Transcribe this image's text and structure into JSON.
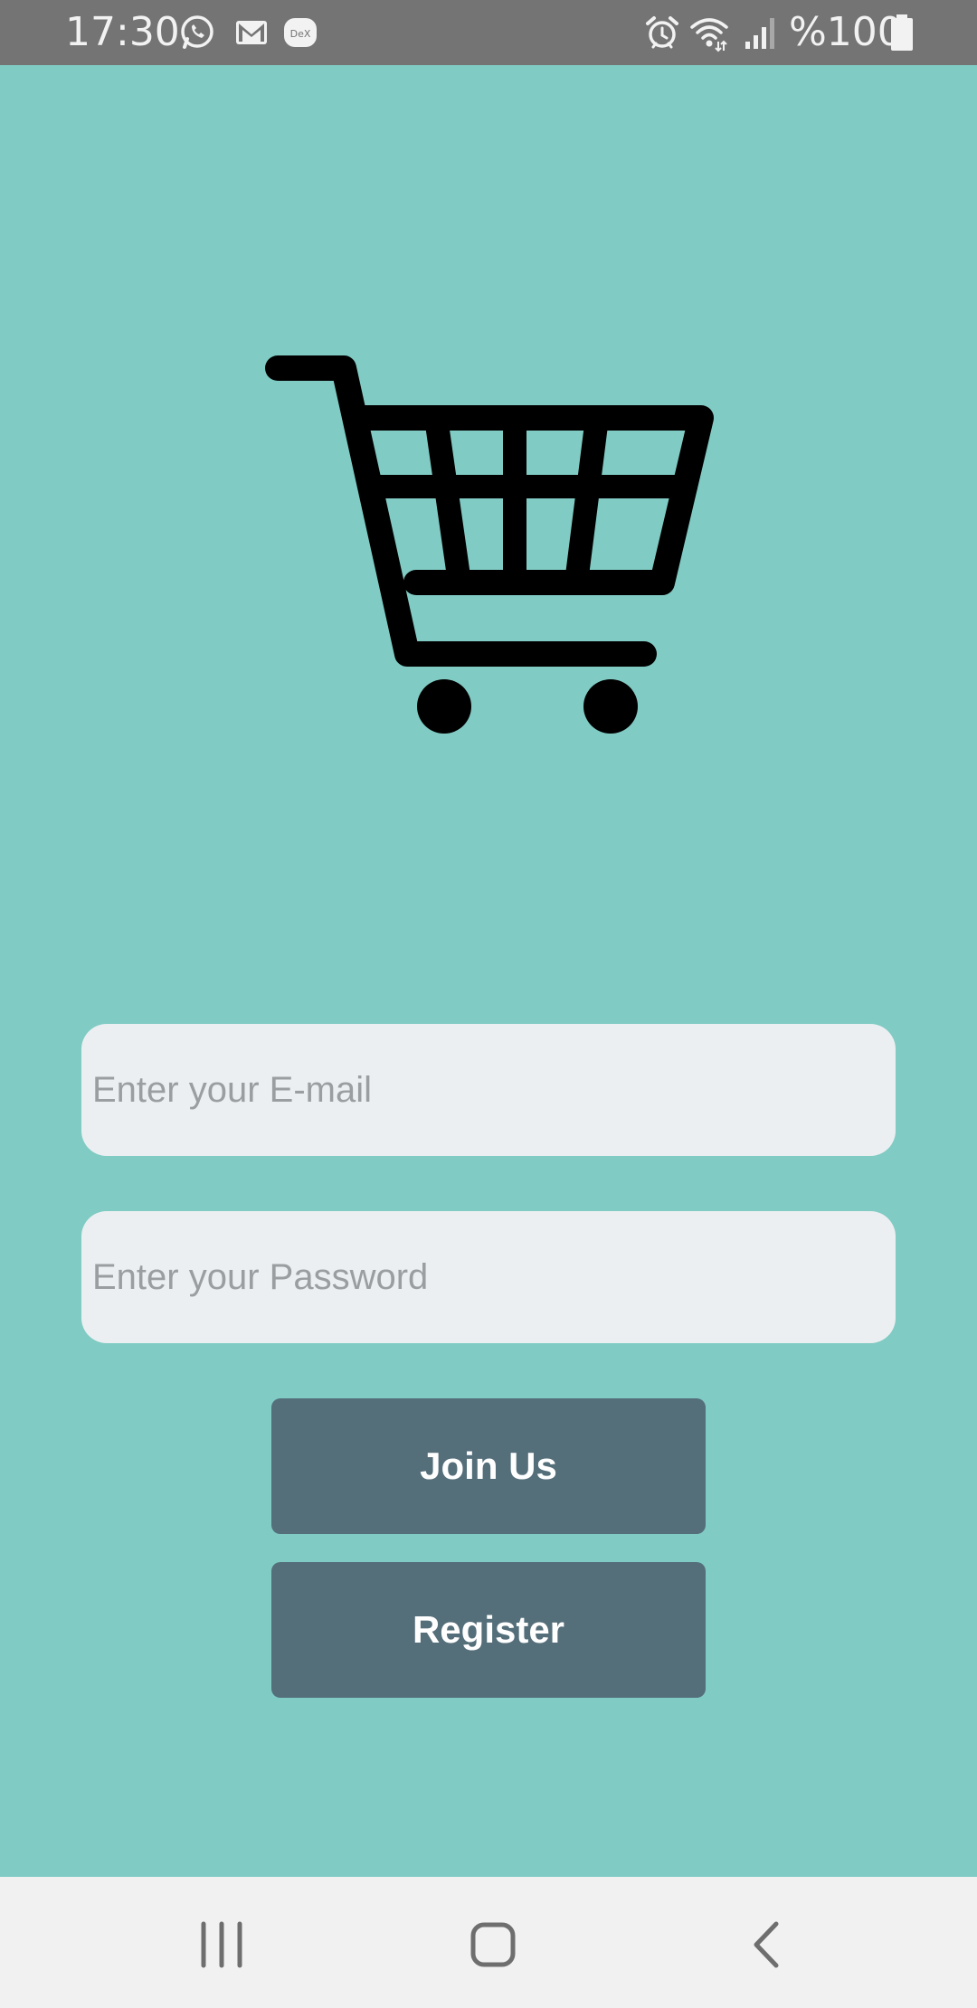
{
  "status_bar": {
    "time": "17:30",
    "battery_text": "%100",
    "icons": [
      "whatsapp-icon",
      "gmail-icon",
      "dex-icon",
      "alarm-icon",
      "wifi-icon",
      "signal-icon",
      "battery-icon"
    ],
    "dex_label": "DeX"
  },
  "login": {
    "logo_icon": "shopping-cart-icon",
    "email_placeholder": "Enter your E-mail",
    "password_placeholder": "Enter your Password",
    "join_label": "Join Us",
    "register_label": "Register"
  },
  "nav_bar": {
    "icons": [
      "recent-apps-icon",
      "home-icon",
      "back-icon"
    ]
  },
  "colors": {
    "background": "#80cbc4",
    "status_bar": "#747474",
    "input_background": "#eceff1",
    "button": "#546e7a",
    "nav_bar": "#f1f1f1"
  }
}
